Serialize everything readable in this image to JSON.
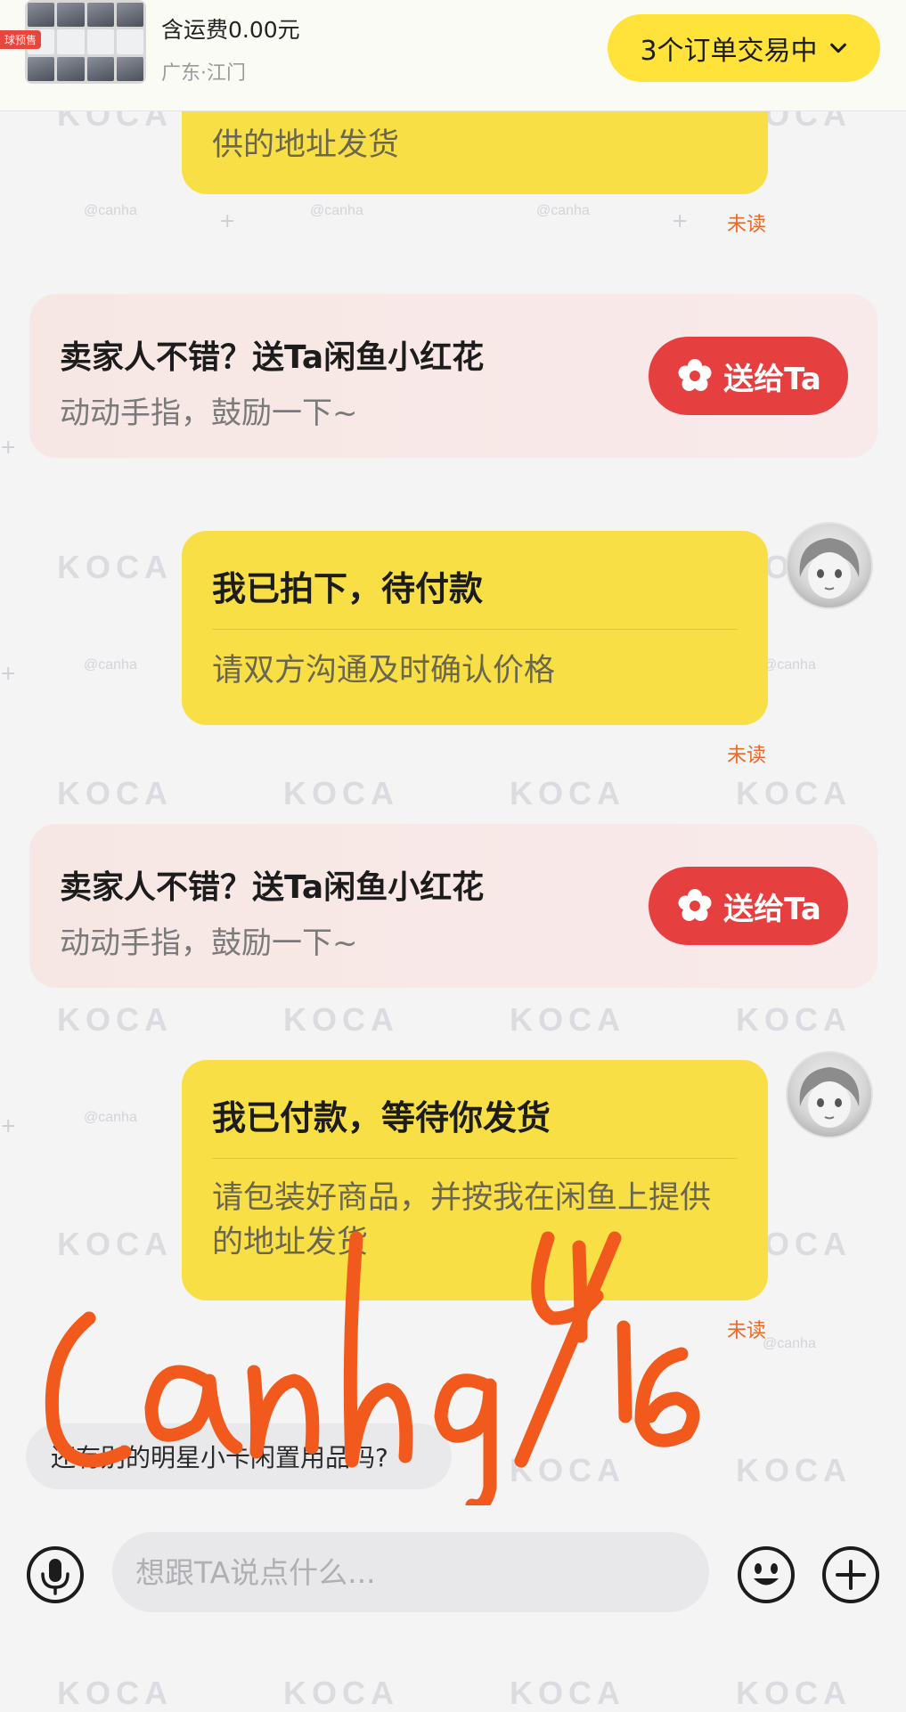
{
  "header": {
    "shipping": "含运费0.00元",
    "location": "广东·江门",
    "thumb_tag": "球预售",
    "orders_button": "3个订单交易中"
  },
  "messages": [
    {
      "type": "bubble_partial",
      "desc": "供的地址发货",
      "status": "未读"
    },
    {
      "type": "flower_card",
      "title": "卖家人不错？送Ta闲鱼小红花",
      "subtitle": "动动手指，鼓励一下~",
      "button": "送给Ta"
    },
    {
      "type": "bubble",
      "title": "我已拍下，待付款",
      "desc": "请双方沟通及时确认价格",
      "status": "未读"
    },
    {
      "type": "flower_card",
      "title": "卖家人不错？送Ta闲鱼小红花",
      "subtitle": "动动手指，鼓励一下~",
      "button": "送给Ta"
    },
    {
      "type": "bubble",
      "title": "我已付款，等待你发货",
      "desc": "请包装好商品，并按我在闲鱼上提供的地址发货",
      "status": "未读"
    }
  ],
  "suggestion": "还有别的明星小卡闲置用品吗?",
  "input": {
    "placeholder": "想跟TA说点什么..."
  },
  "watermark": {
    "logo": "KOCA",
    "handle": "@canha",
    "handwritten": "Canha 4/16"
  },
  "colors": {
    "accent_yellow": "#ffe23a",
    "bubble_yellow": "#f7df45",
    "send_red": "#e63f3f",
    "unread_orange": "#e86a2a"
  },
  "icons": {
    "mic": "microphone-icon",
    "emoji": "smiley-icon",
    "plus": "plus-circle-icon",
    "flower": "flower-icon",
    "chevron": "chevron-down-icon"
  }
}
